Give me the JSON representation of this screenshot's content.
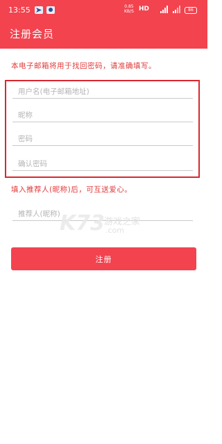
{
  "status_bar": {
    "time": "13:55",
    "speed_value": "0.85",
    "speed_unit": "KB/S",
    "network": "HD",
    "signal1": "4G",
    "signal2": "4G",
    "battery": "86"
  },
  "header": {
    "title": "注册会员"
  },
  "notice": "本电子邮箱将用于找回密码，请准确填写。",
  "form": {
    "username_placeholder": "用户名(电子邮箱地址)",
    "nickname_placeholder": "昵称",
    "password_placeholder": "密码",
    "confirm_placeholder": "确认密码",
    "referrer_placeholder": "推荐人(昵称)"
  },
  "referrer_note": "填入推荐人(昵称)后，可互送爱心。",
  "register_label": "注册",
  "watermark": {
    "logo": "K73",
    "text": "游戏之家",
    "domain": ".com"
  },
  "colors": {
    "primary": "#f2434f",
    "notice_text": "#e03a3a",
    "highlight_border": "#d9272e"
  }
}
